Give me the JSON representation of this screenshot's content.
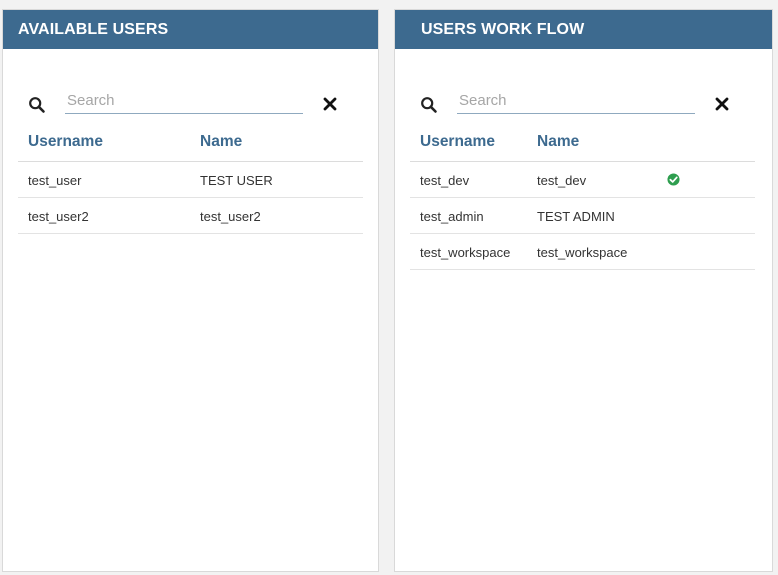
{
  "available": {
    "title": "AVAILABLE USERS",
    "search_placeholder": "Search",
    "columns": {
      "username": "Username",
      "name": "Name"
    },
    "rows": [
      {
        "username": "test_user",
        "name": "TEST USER"
      },
      {
        "username": "test_user2",
        "name": "test_user2"
      }
    ]
  },
  "workflow": {
    "title": "USERS WORK FLOW",
    "search_placeholder": "Search",
    "columns": {
      "username": "Username",
      "name": "Name"
    },
    "rows": [
      {
        "username": "test_dev",
        "name": "test_dev",
        "status_icon": "check-circle-icon"
      },
      {
        "username": "test_admin",
        "name": "TEST ADMIN"
      },
      {
        "username": "test_workspace",
        "name": "test_workspace"
      }
    ]
  },
  "colors": {
    "header_bg": "#3d6a8f",
    "header_text": "#ffffff",
    "accent": "#3d6a8f",
    "ok_green": "#2e9e4f"
  },
  "icons": {
    "search": "search-icon",
    "clear": "close-icon",
    "status": "check-circle-icon"
  }
}
